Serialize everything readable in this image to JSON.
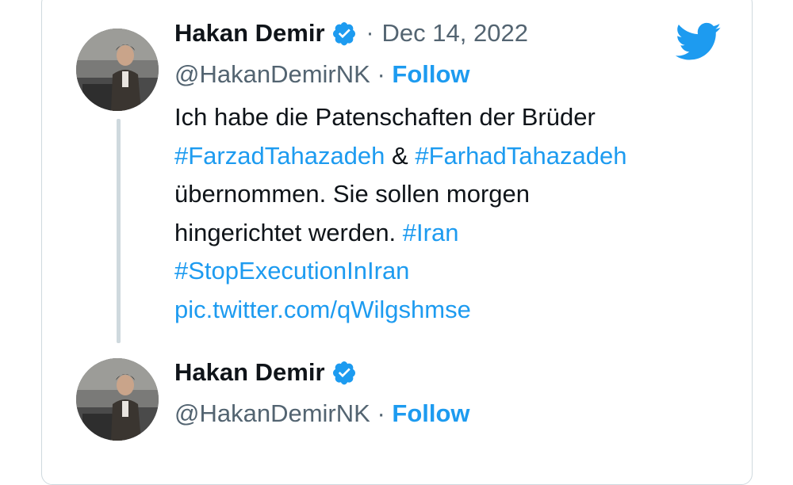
{
  "brand": {
    "accent": "#1d9bf0",
    "text": "#0f1419",
    "muted": "#536471",
    "border": "#cfd9de"
  },
  "tweet": {
    "author_name": "Hakan Demir",
    "handle": "@HakanDemirNK",
    "dot": "·",
    "date": "Dec 14, 2022",
    "follow_label": "Follow",
    "text": {
      "line1": "Ich habe die Patenschaften der Brüder",
      "hashtag_farzad": "#FarzadTahazadeh",
      "amp": " & ",
      "hashtag_farhad": "#FarhadTahazadeh",
      "line3": "übernommen. Sie sollen morgen",
      "line4": "hingerichtet werden. ",
      "hashtag_iran": "#Iran",
      "hashtag_stop": "#StopExecutionInIran",
      "pic_link": "pic.twitter.com/qWilgshmse"
    }
  },
  "reply": {
    "author_name": "Hakan Demir",
    "handle": "@HakanDemirNK",
    "dot": "·",
    "follow_label": "Follow"
  },
  "icons": {
    "logo": "twitter-bird-icon",
    "verified": "verified-badge-icon"
  }
}
